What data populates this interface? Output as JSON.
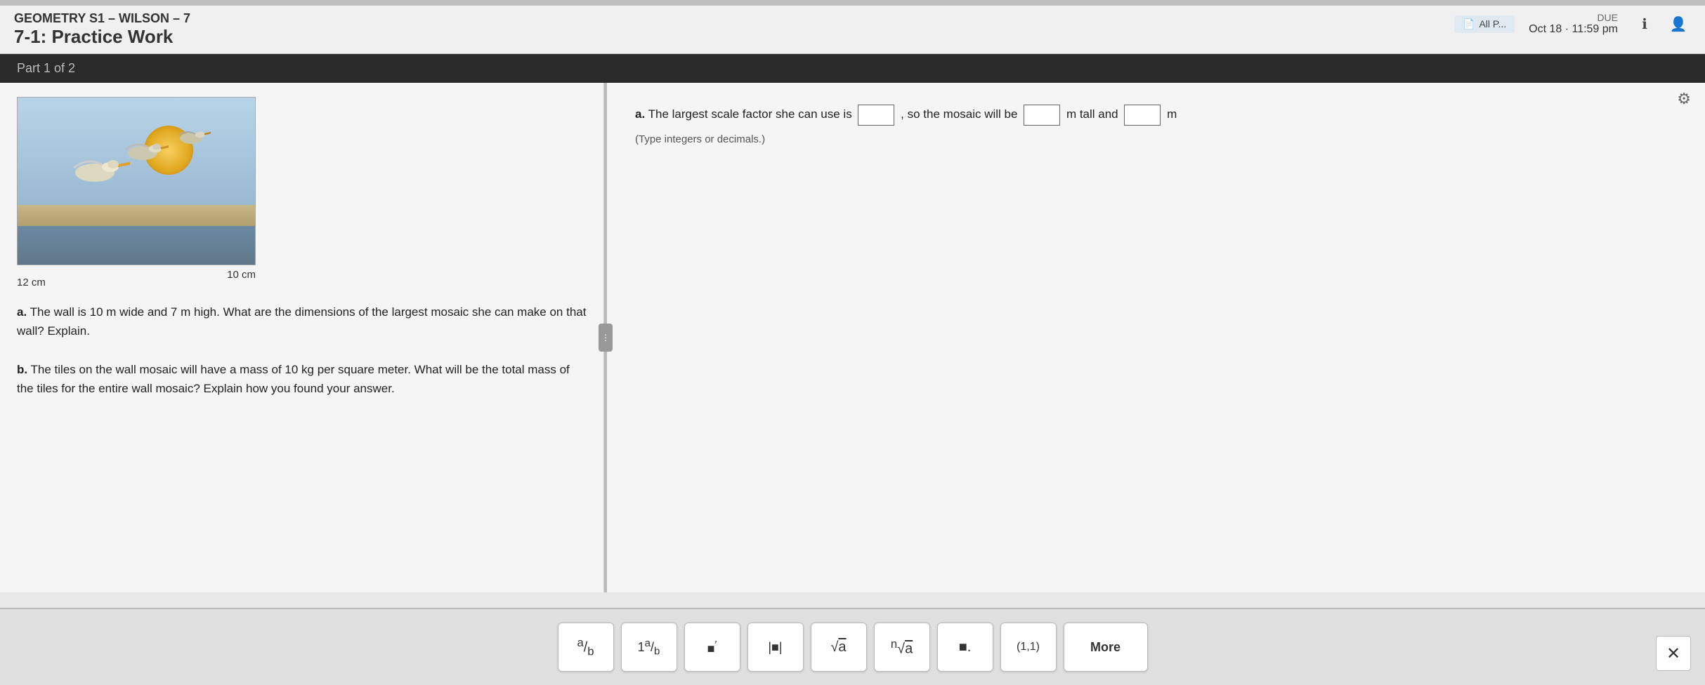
{
  "header": {
    "course_name": "GEOMETRY S1 – WILSON – 7",
    "assignment_name": "7-1: Practice Work",
    "due_label": "DUE",
    "due_date": "Oct 18 · 11:59 pm",
    "info_icon": "ℹ",
    "user_icon": "👤",
    "tab_label": "All P..."
  },
  "part_indicator": "Part 1 of 2",
  "image": {
    "width_label": "10 cm",
    "height_label": "12 cm"
  },
  "question": {
    "part_a_label": "a.",
    "part_a_text": "The wall is 10 m wide and 7 m high. What are the dimensions of the largest mosaic she can make on that wall? Explain.",
    "part_b_label": "b.",
    "part_b_text": "The tiles on the wall mosaic will have a mass of 10 kg per square meter. What will be the total mass of the tiles for the entire wall mosaic? Explain how you found your answer."
  },
  "answer": {
    "part_a_label": "a.",
    "prefix": "The largest scale factor she can use is",
    "input_scale_placeholder": "",
    "middle_text": ", so the mosaic will be",
    "input_tall_placeholder": "",
    "tall_label": "m tall and",
    "input_wide_placeholder": "",
    "wide_label": "m",
    "note": "(Type integers or decimals.)"
  },
  "toolbar": {
    "buttons": [
      {
        "id": "fraction",
        "symbol": "½",
        "label": "fraction"
      },
      {
        "id": "mixed-number",
        "symbol": "1½",
        "label": "mixed number"
      },
      {
        "id": "superscript",
        "symbol": "■'",
        "label": "superscript"
      },
      {
        "id": "absolute-value",
        "symbol": "|■|",
        "label": "absolute value"
      },
      {
        "id": "sqrt",
        "symbol": "√a",
        "label": "square root"
      },
      {
        "id": "nth-root",
        "symbol": "∛a",
        "label": "nth root"
      },
      {
        "id": "decimal",
        "symbol": "■.",
        "label": "decimal"
      },
      {
        "id": "ordered-pair",
        "symbol": "(1,1)",
        "label": "ordered pair"
      },
      {
        "id": "more",
        "symbol": "More",
        "label": "more"
      }
    ],
    "close_label": "✕"
  },
  "settings_icon": "⚙",
  "colors": {
    "header_bg": "#f0f0f0",
    "part_bar_bg": "#2a2a2a",
    "content_bg": "#f5f5f5",
    "toolbar_bg": "#e0e0e0",
    "accent": "#3a7abf"
  }
}
